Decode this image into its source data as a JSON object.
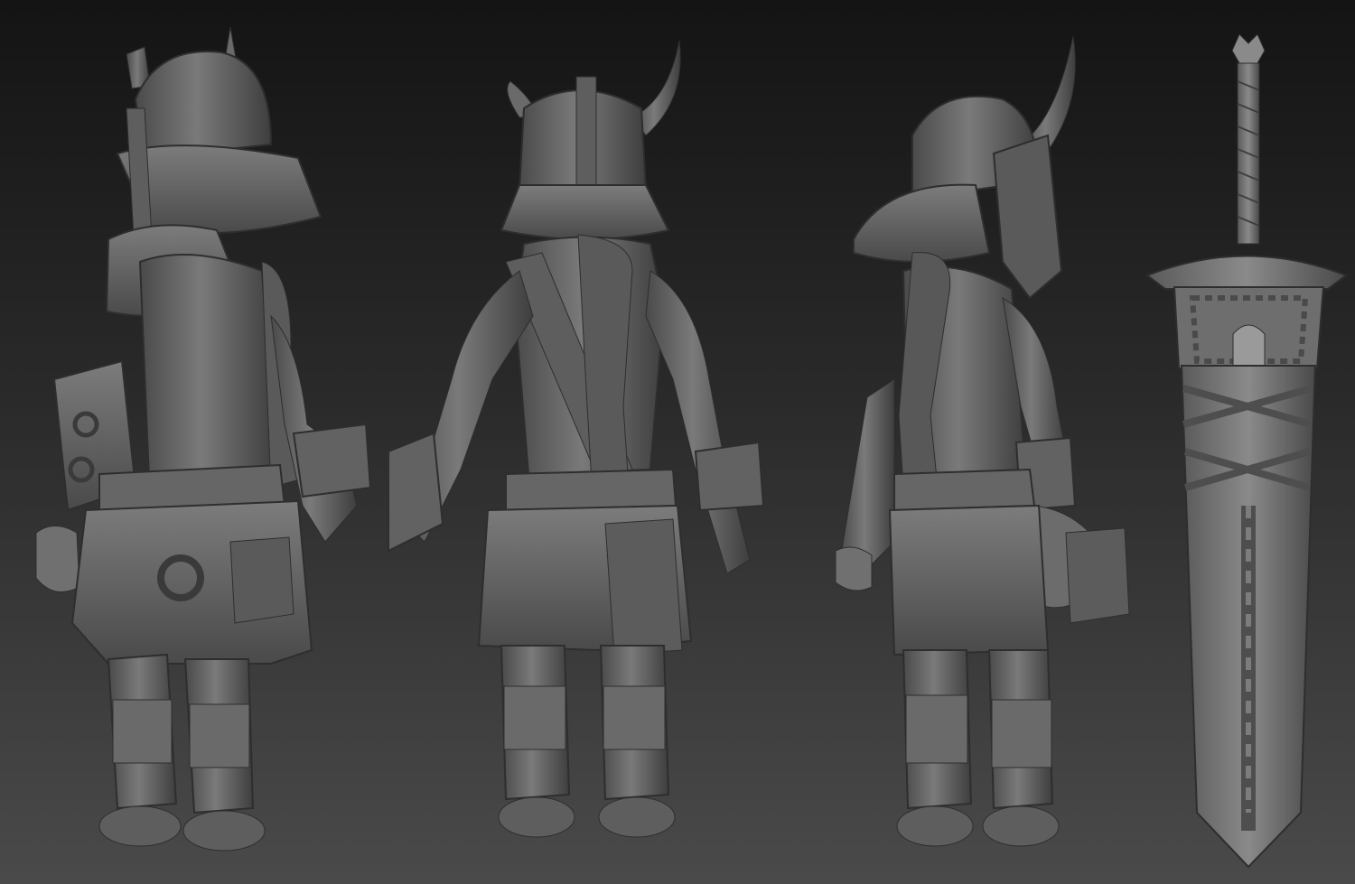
{
  "scene": {
    "background_top": "#141414",
    "background_bottom": "#4a4a4a",
    "material_color": "#6e6e6e",
    "material_shadow": "#3a3a3a",
    "material_highlight": "#9a9a9a",
    "views": [
      {
        "name": "three-quarter-back-left",
        "subject": "armored-warrior-figure"
      },
      {
        "name": "back",
        "subject": "armored-warrior-figure"
      },
      {
        "name": "three-quarter-back-right",
        "subject": "armored-warrior-figure"
      },
      {
        "name": "sword",
        "subject": "greatsword-prop"
      }
    ]
  }
}
